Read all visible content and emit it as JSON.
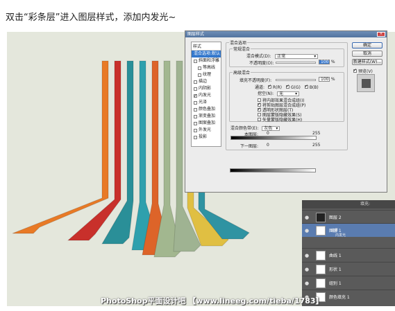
{
  "caption": "双击“彩条层”进入图层样式，添加内发光~",
  "colors": {
    "stripes": [
      "#e87a26",
      "#c8302b",
      "#2a8f98",
      "#2ea0ad",
      "#dd6429",
      "#a2b78f",
      "#9fb392",
      "#e0bf42",
      "#2f93a2"
    ]
  },
  "dialog": {
    "title": "图层样式",
    "close_icon": "close-icon",
    "styles_header": "样式",
    "styles_items": [
      {
        "label": "混合选项:默认",
        "checked": null,
        "sub": false,
        "selected": true
      },
      {
        "label": "斜面和浮雕",
        "checked": false,
        "sub": false,
        "selected": false
      },
      {
        "label": "等高线",
        "checked": false,
        "sub": true,
        "selected": false
      },
      {
        "label": "纹理",
        "checked": false,
        "sub": true,
        "selected": false
      },
      {
        "label": "描边",
        "checked": false,
        "sub": false,
        "selected": false
      },
      {
        "label": "内阴影",
        "checked": false,
        "sub": false,
        "selected": false
      },
      {
        "label": "内发光",
        "checked": true,
        "sub": false,
        "selected": false
      },
      {
        "label": "光泽",
        "checked": false,
        "sub": false,
        "selected": false
      },
      {
        "label": "颜色叠加",
        "checked": false,
        "sub": false,
        "selected": false
      },
      {
        "label": "渐变叠加",
        "checked": false,
        "sub": false,
        "selected": false
      },
      {
        "label": "图案叠加",
        "checked": false,
        "sub": false,
        "selected": false
      },
      {
        "label": "外发光",
        "checked": false,
        "sub": false,
        "selected": false
      },
      {
        "label": "投影",
        "checked": false,
        "sub": false,
        "selected": false
      }
    ],
    "blend_options_title": "混合选项",
    "general_blending_title": "常规混合",
    "blend_mode_label": "混合模式(D):",
    "blend_mode_value": "正常",
    "opacity_label": "不透明度(O):",
    "opacity_value": "100",
    "percent": "%",
    "advanced_title": "高级混合",
    "fill_opacity_label": "填充不透明度(F):",
    "fill_opacity_value": "100",
    "channels_label": "通道:",
    "channel_r": "R(R)",
    "channel_g": "G(G)",
    "channel_b": "B(B)",
    "knockout_label": "挖空(N):",
    "knockout_value": "无",
    "adv_options": [
      {
        "label": "将内部效果混合成组(I)",
        "checked": false
      },
      {
        "label": "将剪贴图层混合成组(P)",
        "checked": true
      },
      {
        "label": "透明形状图层(T)",
        "checked": true
      },
      {
        "label": "图层蒙版隐藏效果(S)",
        "checked": false
      },
      {
        "label": "矢量蒙版隐藏效果(H)",
        "checked": false
      }
    ],
    "blend_if_label": "混合颜色带(E):",
    "blend_if_value": "灰色",
    "this_layer_label": "本图层:",
    "this_layer_min": "0",
    "this_layer_max": "255",
    "underlying_label": "下一图层:",
    "underlying_min": "0",
    "underlying_max": "255",
    "ok_label": "确定",
    "cancel_label": "取消",
    "new_style_label": "新建样式(W)...",
    "preview_label": "预览(V)",
    "preview_checked": true
  },
  "layers": {
    "header": "填充:",
    "items": [
      {
        "name": "图层 2",
        "thumb": "dark",
        "selected": false
      },
      {
        "name": "图层 1",
        "thumb": "light",
        "selected": true
      },
      {
        "name": "曲线 1",
        "thumb": "light",
        "selected": false
      },
      {
        "name": "形状 1",
        "thumb": "light",
        "selected": false
      },
      {
        "name": "组别 1",
        "thumb": "light",
        "selected": false
      },
      {
        "name": "颜色填充 1",
        "thumb": "light",
        "selected": false
      }
    ],
    "fx_label": "效果",
    "fx_item": "内发光"
  },
  "watermark": "PhotoShop平面设计吧 【www.lineeg.com/tieba/1783】"
}
